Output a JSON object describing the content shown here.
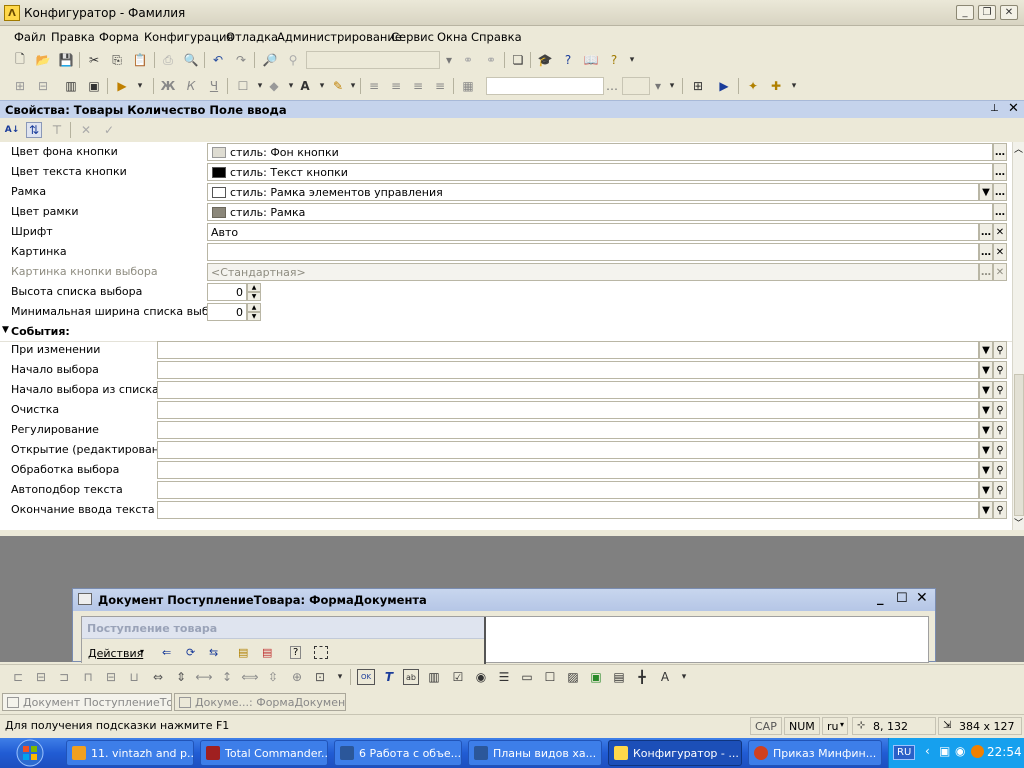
{
  "window": {
    "title": "Конфигуратор - Фамилия"
  },
  "menu": [
    "Файл",
    "Правка",
    "Форма",
    "Конфигурация",
    "Отладка",
    "Администрирование",
    "Сервис",
    "Окна",
    "Справка"
  ],
  "panel": {
    "title": "Свойства: Товары Количество Поле ввода"
  },
  "properties": [
    {
      "label": "Цвет фона кнопки",
      "value": "стиль: Фон кнопки",
      "swatch": "#dedcd2"
    },
    {
      "label": "Цвет текста кнопки",
      "value": "стиль: Текст кнопки",
      "swatch": "#000000"
    },
    {
      "label": "Рамка",
      "value": "стиль: Рамка элементов управления",
      "swatch": "#ffffff"
    },
    {
      "label": "Цвет рамки",
      "value": "стиль: Рамка",
      "swatch": "#8b877a"
    },
    {
      "label": "Шрифт",
      "value": "Авто"
    },
    {
      "label": "Картинка",
      "value": ""
    },
    {
      "label": "Картинка кнопки выбора",
      "value": "<Стандартная>"
    },
    {
      "label": "Высота списка выбора",
      "value": "0"
    },
    {
      "label": "Минимальная ширина списка выбора",
      "value": "0"
    }
  ],
  "events": {
    "header": "События:",
    "items": [
      "При изменении",
      "Начало выбора",
      "Начало выбора из списка",
      "Очистка",
      "Регулирование",
      "Открытие (редактирование)",
      "Обработка выбора",
      "Автоподбор текста",
      "Окончание ввода текста"
    ]
  },
  "mdi": {
    "title": "Документ ПоступлениеТовара: ФормаДокумента",
    "form_title": "Поступление товара",
    "actions": "Действия"
  },
  "window_tabs": [
    "Документ ПоступлениеТов...",
    "Докуме...: ФормаДокумента"
  ],
  "status": {
    "hint": "Для получения подсказки нажмите F1",
    "cap": "CAP",
    "num": "NUM",
    "lang": "ru",
    "pos": "8, 132",
    "size": "384 x 127"
  },
  "taskbar": {
    "tasks": [
      "11. vintazh and p...",
      "Total Commander...",
      "6 Работа с объе...",
      "Планы видов ха...",
      "Конфигуратор - ...",
      "Приказ Минфин..."
    ],
    "lang": "RU",
    "clock": "22:54"
  }
}
